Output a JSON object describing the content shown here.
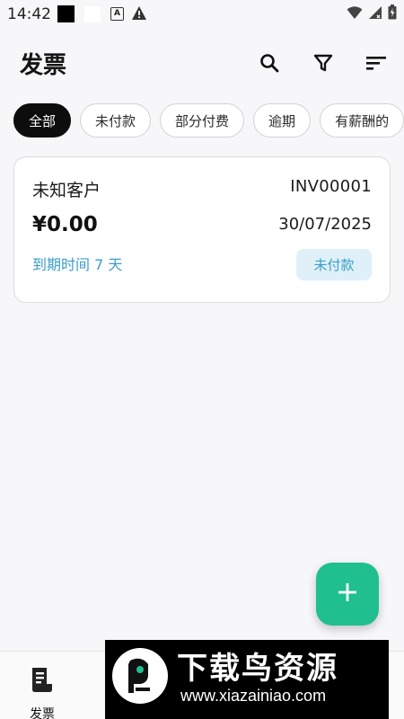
{
  "status_bar": {
    "time": "14:42",
    "a_icon_text": "A",
    "icons": [
      "warning-icon",
      "wifi-icon",
      "signal-icon",
      "battery-icon"
    ]
  },
  "header": {
    "title": "发票",
    "actions": [
      "search-icon",
      "filter-icon",
      "sort-icon"
    ]
  },
  "filters": {
    "chips": [
      "全部",
      "未付款",
      "部分付费",
      "逾期",
      "有薪酬的"
    ],
    "selected": "全部"
  },
  "invoices": [
    {
      "customer": "未知客户",
      "number": "INV00001",
      "amount": "¥0.00",
      "date": "30/07/2025",
      "due": "到期时间 7 天",
      "status": "未付款"
    }
  ],
  "fab": {
    "icon": "plus-icon"
  },
  "bottom_nav": {
    "items": [
      {
        "label": "发票",
        "icon": "invoice-icon"
      }
    ]
  },
  "watermark": {
    "title": "下载鸟资源",
    "url": "www.xiazainiao.com"
  },
  "colors": {
    "accent": "#1fbf8f",
    "status_unpaid_text": "#3b9ec7",
    "status_unpaid_bg": "#dff0f8",
    "chip_active_bg": "#0d0d0d"
  }
}
